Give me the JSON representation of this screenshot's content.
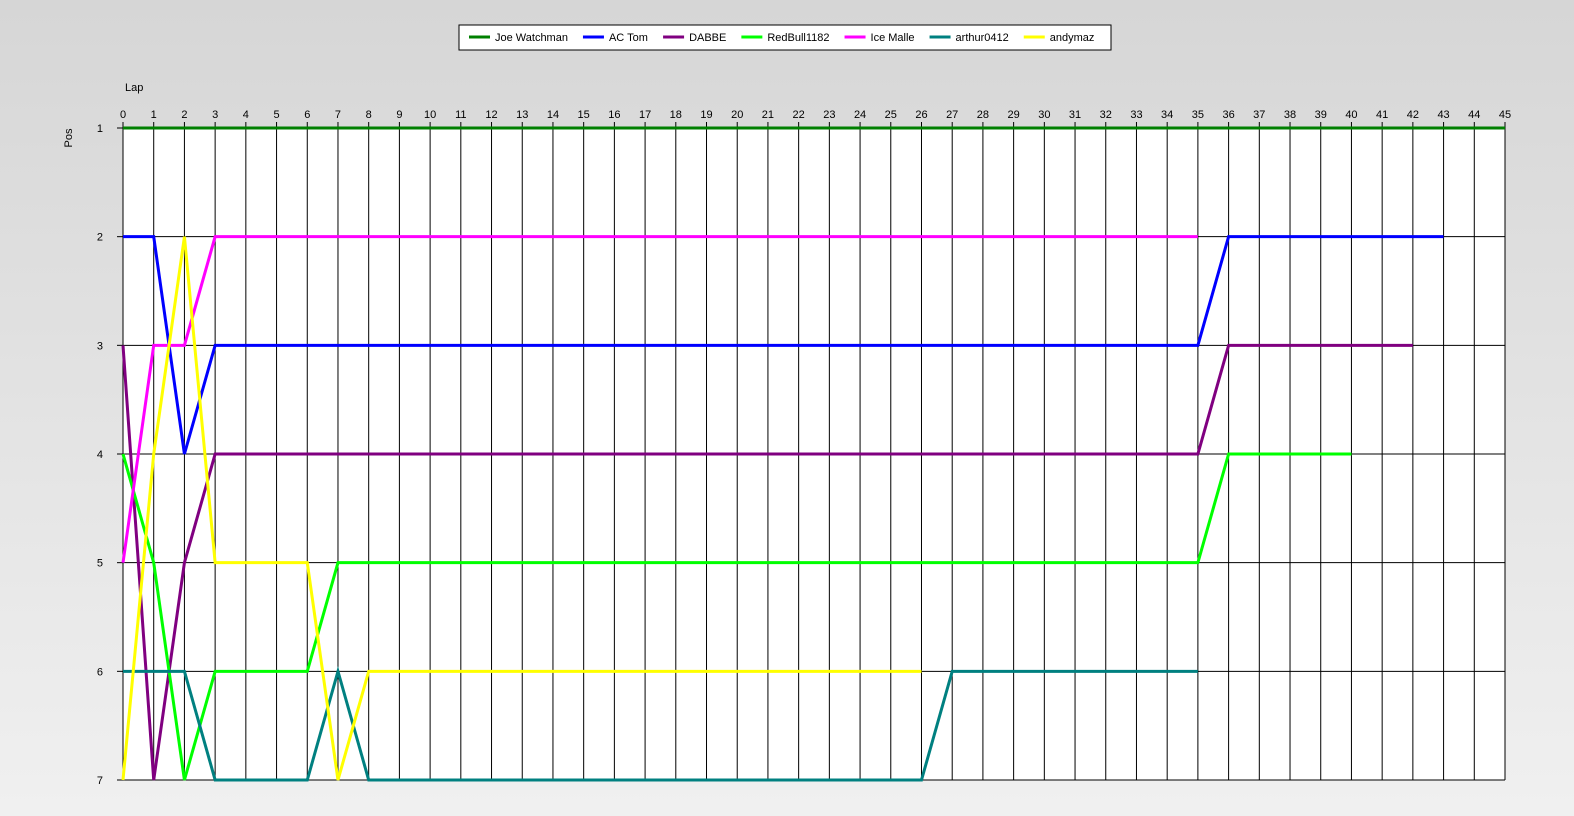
{
  "chart_data": {
    "type": "line",
    "title": "",
    "xlabel": "Lap",
    "ylabel": "Pos",
    "xlim": [
      0,
      45
    ],
    "ylim": [
      1,
      7
    ],
    "y_inverted": true,
    "x_ticks": [
      0,
      1,
      2,
      3,
      4,
      5,
      6,
      7,
      8,
      9,
      10,
      11,
      12,
      13,
      14,
      15,
      16,
      17,
      18,
      19,
      20,
      21,
      22,
      23,
      24,
      25,
      26,
      27,
      28,
      29,
      30,
      31,
      32,
      33,
      34,
      35,
      36,
      37,
      38,
      39,
      40,
      41,
      42,
      43,
      44,
      45
    ],
    "y_ticks": [
      1,
      2,
      3,
      4,
      5,
      6,
      7
    ],
    "grid": true,
    "legend_position": "top",
    "series": [
      {
        "name": "Joe Watchman",
        "color": "#008000",
        "x": [
          0,
          45
        ],
        "y": [
          1,
          1
        ]
      },
      {
        "name": "AC Tom",
        "color": "#0000ff",
        "x": [
          0,
          1,
          2,
          3,
          35,
          36,
          43
        ],
        "y": [
          2,
          2,
          4,
          3,
          3,
          2,
          2
        ]
      },
      {
        "name": "DABBE",
        "color": "#800080",
        "x": [
          0,
          1,
          2,
          3,
          35,
          36,
          42
        ],
        "y": [
          3,
          7,
          5,
          4,
          4,
          3,
          3
        ]
      },
      {
        "name": "RedBull1182",
        "color": "#00ff00",
        "x": [
          0,
          1,
          2,
          3,
          6,
          7,
          35,
          36,
          40
        ],
        "y": [
          4,
          5,
          7,
          6,
          6,
          5,
          5,
          4,
          4
        ]
      },
      {
        "name": "Ice Malle",
        "color": "#ff00ff",
        "x": [
          0,
          1,
          2,
          3,
          35
        ],
        "y": [
          5,
          3,
          3,
          2,
          2
        ]
      },
      {
        "name": "arthur0412",
        "color": "#008080",
        "x": [
          0,
          2,
          3,
          6,
          7,
          8,
          26,
          27,
          35
        ],
        "y": [
          6,
          6,
          7,
          7,
          6,
          7,
          7,
          6,
          6
        ]
      },
      {
        "name": "andymaz",
        "color": "#ffff00",
        "x": [
          0,
          1,
          2,
          3,
          6,
          7,
          8,
          26
        ],
        "y": [
          7,
          4,
          2,
          5,
          5,
          7,
          6,
          6
        ]
      }
    ]
  }
}
